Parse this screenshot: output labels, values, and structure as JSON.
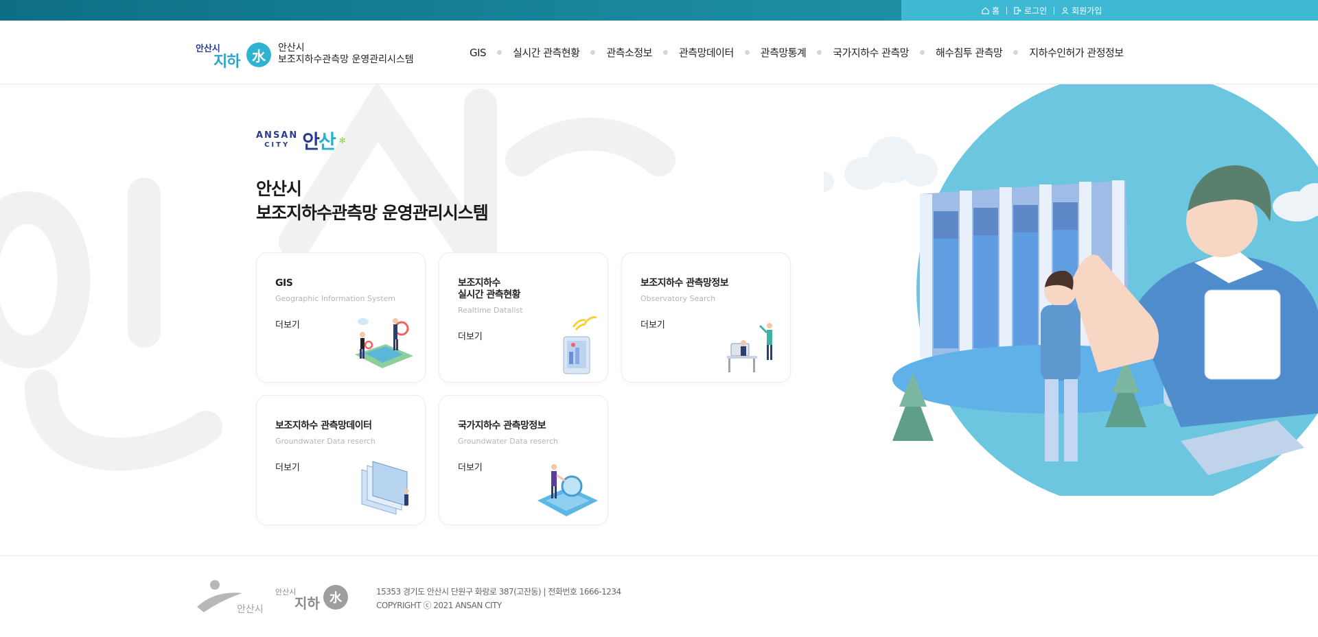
{
  "topbar": {
    "links": [
      {
        "label": "홈",
        "icon": "home-icon"
      },
      {
        "label": "로그인",
        "icon": "login-icon"
      },
      {
        "label": "회원가입",
        "icon": "user-icon"
      }
    ]
  },
  "header": {
    "logo_small": "안산시",
    "logo_big": "지하",
    "logo_badge": "水",
    "logo_line1": "안산시",
    "logo_line2": "보조지하수관측망 운영관리시스템",
    "nav": [
      "GIS",
      "실시간 관측현황",
      "관측소정보",
      "관측망데이터",
      "관측망통계",
      "국가지하수 관측망",
      "해수침투 관측망",
      "지하수인허가 관정정보"
    ]
  },
  "hero": {
    "brand_en_1": "ANSAN",
    "brand_en_2": "CITY",
    "brand_ko_a": "안",
    "brand_ko_b": "산",
    "title_line1": "안산시",
    "title_line2": "보조지하수관측망 운영관리시스템",
    "cards": [
      {
        "title": "GIS",
        "subtitle": "Geographic Information System",
        "more": "더보기",
        "icon": "map-people-illustration"
      },
      {
        "title": "보조지하수\n실시간 관측현황",
        "subtitle": "Realtime Datalist",
        "more": "더보기",
        "icon": "tablet-signal-illustration"
      },
      {
        "title": "보조지하수 관측망정보",
        "subtitle": "Observatory Search",
        "more": "더보기",
        "icon": "computer-desk-illustration"
      },
      {
        "title": "보조지하수 관측망데이터",
        "subtitle": "Groundwater Data reserch",
        "more": "더보기",
        "icon": "documents-illustration"
      },
      {
        "title": "국가지하수 관측망정보",
        "subtitle": "Groundwater Data reserch",
        "more": "더보기",
        "icon": "magnifier-person-illustration"
      }
    ]
  },
  "footer": {
    "address": "15353 경기도 안산시 단원구 화랑로 387(고잔동) | 전화번호 1666-1234",
    "copyright": "COPYRIGHT ⓒ 2021 ANSAN CITY",
    "logo_city": "안산시",
    "logo_small": "안산시",
    "logo_big": "지하",
    "logo_badge": "水"
  },
  "colors": {
    "topbar_dark": "#0e6e86",
    "topbar_light": "#3fb8d4",
    "brand_blue": "#2a3b8f",
    "brand_cyan": "#23b1cf",
    "hero_circle": "#6cc6df"
  }
}
